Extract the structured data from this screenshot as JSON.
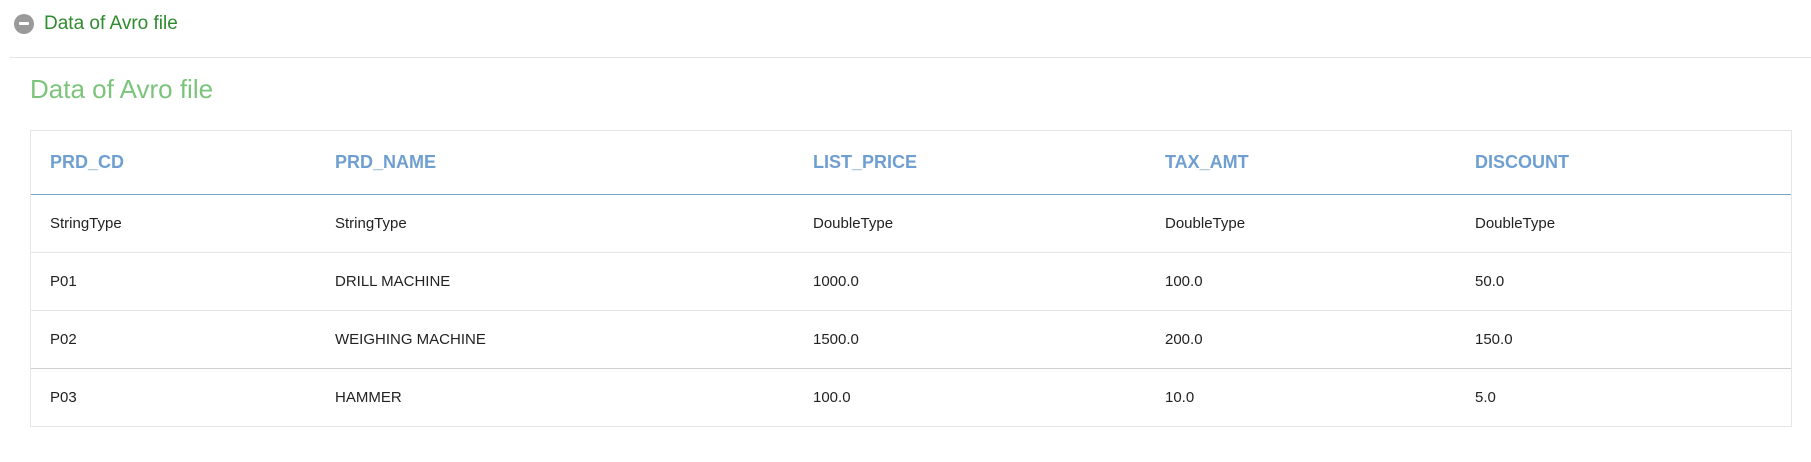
{
  "section": {
    "header_label": "Data of Avro file",
    "icon": "minus-circle-icon"
  },
  "content": {
    "title": "Data of Avro file"
  },
  "table": {
    "columns": [
      "PRD_CD",
      "PRD_NAME",
      "LIST_PRICE",
      "TAX_AMT",
      "DISCOUNT"
    ],
    "rows": [
      [
        "StringType",
        "StringType",
        "DoubleType",
        "DoubleType",
        "DoubleType"
      ],
      [
        "P01",
        "DRILL MACHINE",
        "1000.0",
        "100.0",
        "50.0"
      ],
      [
        "P02",
        "WEIGHING MACHINE",
        "1500.0",
        "200.0",
        "150.0"
      ],
      [
        "P03",
        "HAMMER",
        "100.0",
        "10.0",
        "5.0"
      ]
    ]
  },
  "colors": {
    "header_label": "#2e8b2e",
    "title": "#7cc47c",
    "column_header": "#6f9fd0"
  }
}
